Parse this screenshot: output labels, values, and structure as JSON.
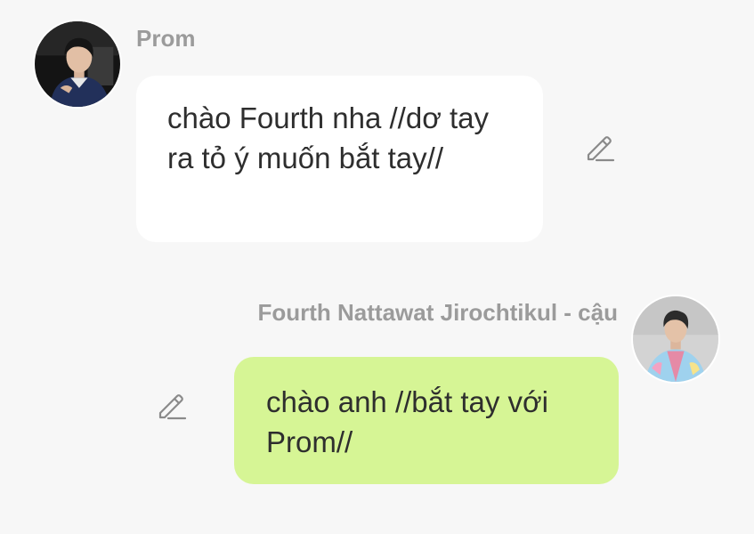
{
  "messages": [
    {
      "sender": "Prom",
      "text": "chào Fourth nha //dơ tay ra tỏ ý muốn bắt tay//",
      "bubble_color": "#ffffff",
      "avatar_icon": "avatar-photo-prom"
    },
    {
      "sender": "Fourth Nattawat Jirochtikul - cậu",
      "text": "chào anh //bắt tay với Prom//",
      "bubble_color": "#d6f595",
      "avatar_icon": "avatar-photo-fourth"
    }
  ],
  "icons": {
    "edit": "pencil-edit-icon"
  },
  "colors": {
    "background": "#f7f7f7",
    "name_text": "#9b9b9b",
    "message_text": "#2e2e2e",
    "sent_bubble": "#d6f595",
    "received_bubble": "#ffffff",
    "icon_stroke": "#8a8a8a"
  }
}
